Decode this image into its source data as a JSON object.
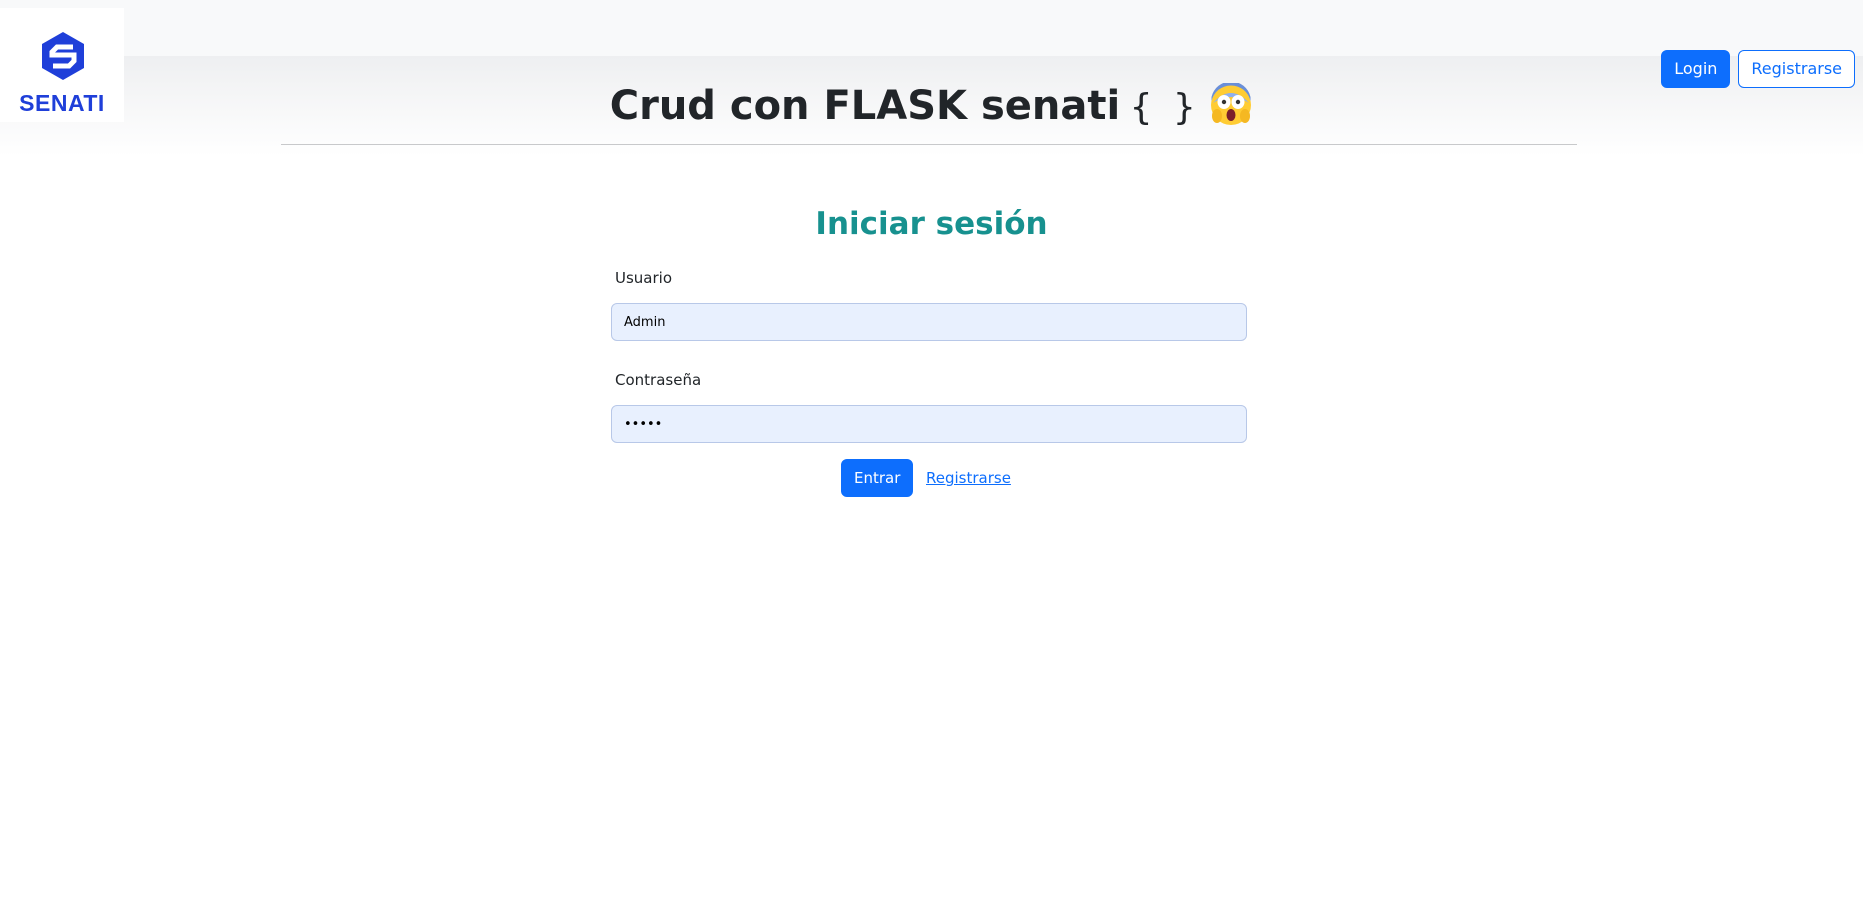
{
  "logo": {
    "text": "SENATI",
    "icon": "senati-logo-icon",
    "color": "#1f3fd9"
  },
  "nav": {
    "login_label": "Login",
    "register_label": "Registrarse"
  },
  "header": {
    "title": "Crud con FLASK senati",
    "braces": "{ }",
    "emoji": "face-screaming-in-fear-icon"
  },
  "form": {
    "heading": "Iniciar sesión",
    "username_label": "Usuario",
    "username_value": "Admin",
    "password_label": "Contraseña",
    "password_value": "•••••",
    "submit_label": "Entrar",
    "register_link": "Registrarse"
  },
  "colors": {
    "primary": "#0d6efd",
    "heading": "#17918f",
    "input_bg": "#e8f0fe"
  }
}
